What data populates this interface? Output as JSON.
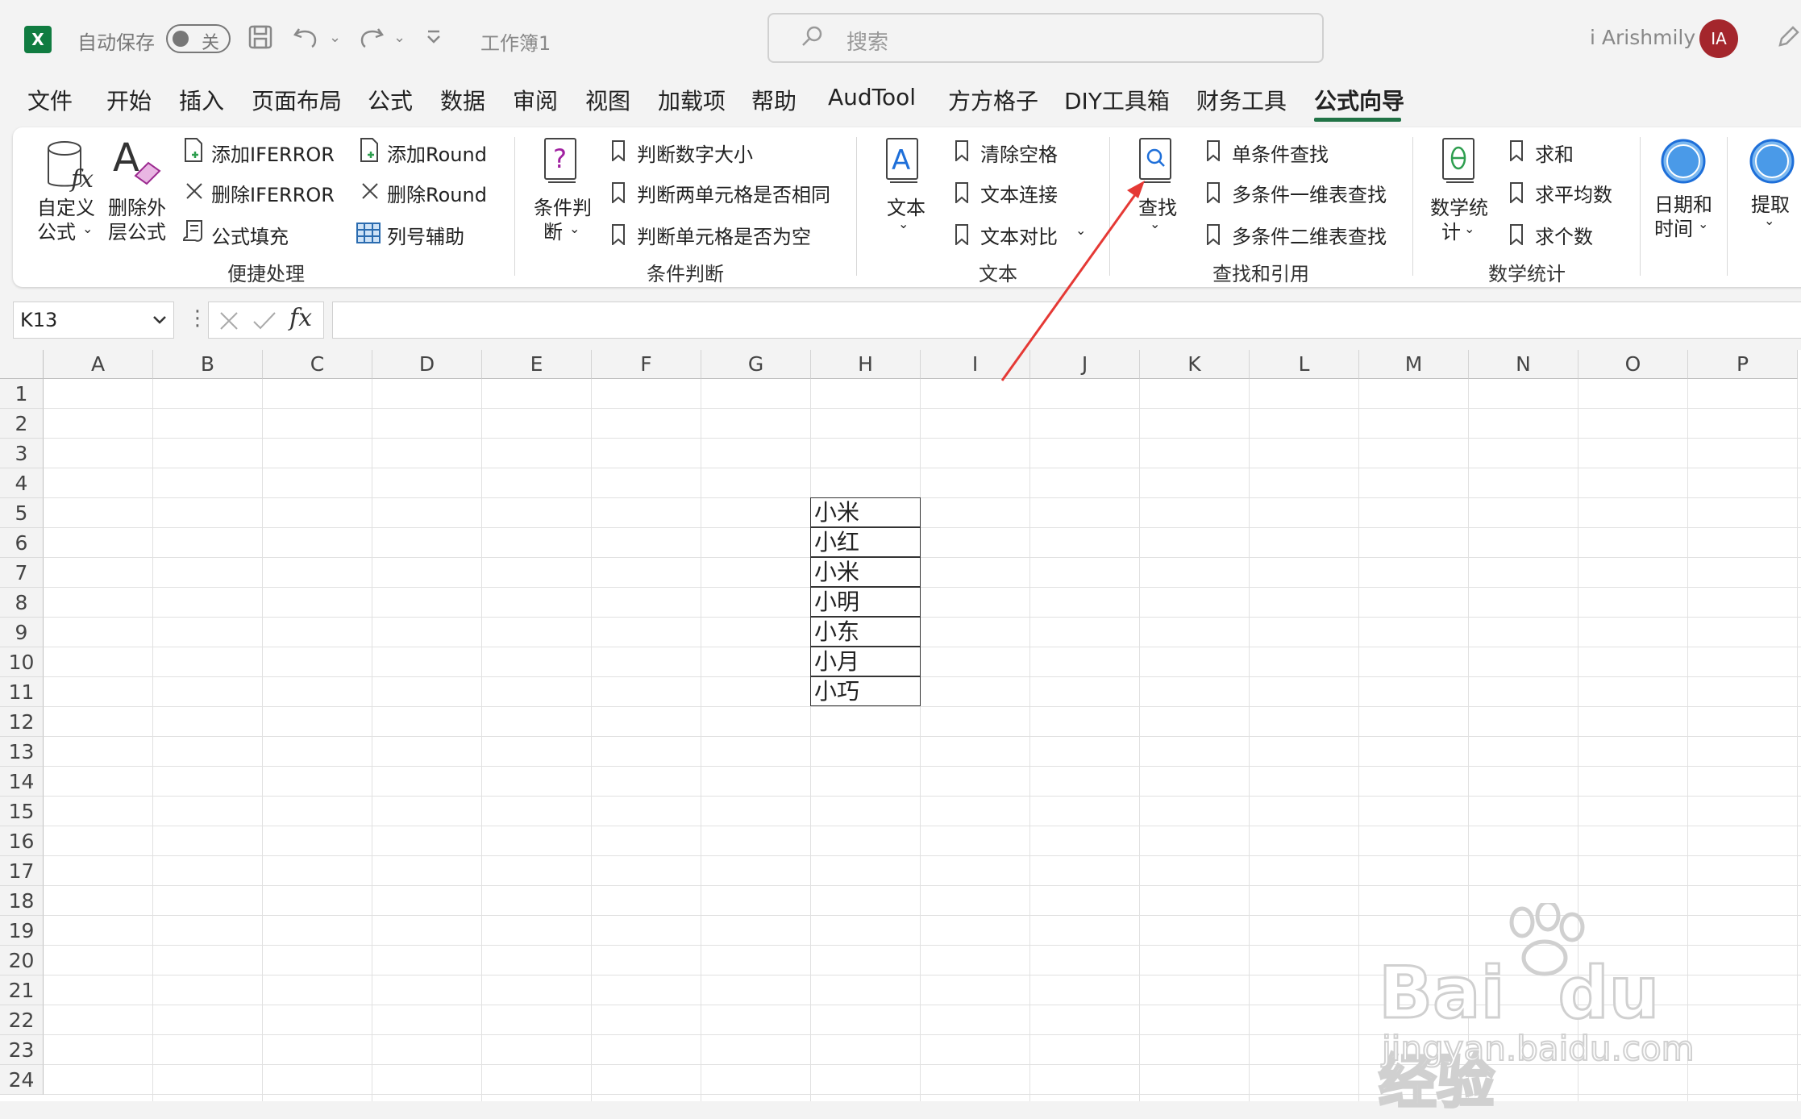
{
  "titlebar": {
    "autosave_label": "自动保存",
    "toggle_state": "关",
    "doc_title": "工作簿1",
    "search_placeholder": "搜索",
    "user_name": "i Arishmily",
    "avatar_initials": "IA"
  },
  "tabs": [
    "文件",
    "开始",
    "插入",
    "页面布局",
    "公式",
    "数据",
    "审阅",
    "视图",
    "加载项",
    "帮助",
    "AudTool",
    "方方格子",
    "DIY工具箱",
    "财务工具",
    "公式向导"
  ],
  "active_tab": "公式向导",
  "ribbon": {
    "g1": {
      "label": "便捷处理",
      "custom_formula": [
        "自定义",
        "公式"
      ],
      "delete_outer": [
        "删除外",
        "层公式"
      ],
      "add_iferror": "添加IFERROR",
      "del_iferror": "删除IFERROR",
      "formula_fill": "公式填充",
      "add_round": "添加Round",
      "del_round": "删除Round",
      "col_helper": "列号辅助"
    },
    "g2": {
      "label": "条件判断",
      "cond_judge": [
        "条件判",
        "断"
      ],
      "items": [
        "判断数字大小",
        "判断两单元格是否相同",
        "判断单元格是否为空"
      ]
    },
    "g3": {
      "label": "文本",
      "text_btn": "文本",
      "items": [
        "清除空格",
        "文本连接",
        "文本对比"
      ]
    },
    "g4": {
      "label": "查找和引用",
      "find_btn": "查找",
      "items": [
        "单条件查找",
        "多条件一维表查找",
        "多条件二维表查找"
      ]
    },
    "g5": {
      "label": "数学统计",
      "math_btn": [
        "数学统",
        "计"
      ],
      "items": [
        "求和",
        "求平均数",
        "求个数"
      ]
    },
    "g6": {
      "date_btn": [
        "日期和",
        "时间"
      ]
    },
    "g7": {
      "extract_btn": "提取"
    }
  },
  "formula_bar": {
    "namebox": "K13",
    "fx": "fx",
    "formula": ""
  },
  "columns": [
    "A",
    "B",
    "C",
    "D",
    "E",
    "F",
    "G",
    "H",
    "I",
    "J",
    "K",
    "L",
    "M",
    "N",
    "O",
    "P"
  ],
  "rows": [
    "1",
    "2",
    "3",
    "4",
    "5",
    "6",
    "7",
    "8",
    "9",
    "10",
    "11",
    "12",
    "13",
    "14",
    "15",
    "16",
    "17",
    "18",
    "19",
    "20",
    "21",
    "22",
    "23",
    "24"
  ],
  "cells_H5_H11": [
    "小米",
    "小红",
    "小米",
    "小明",
    "小东",
    "小月",
    "小巧"
  ],
  "watermark": {
    "brand": "Bai",
    "brand2": "du",
    "cn": "经验",
    "url": "jingyan.baidu.com"
  },
  "colors": {
    "accent": "#217346",
    "arrow": "#e53935",
    "avatar": "#a4262c"
  }
}
